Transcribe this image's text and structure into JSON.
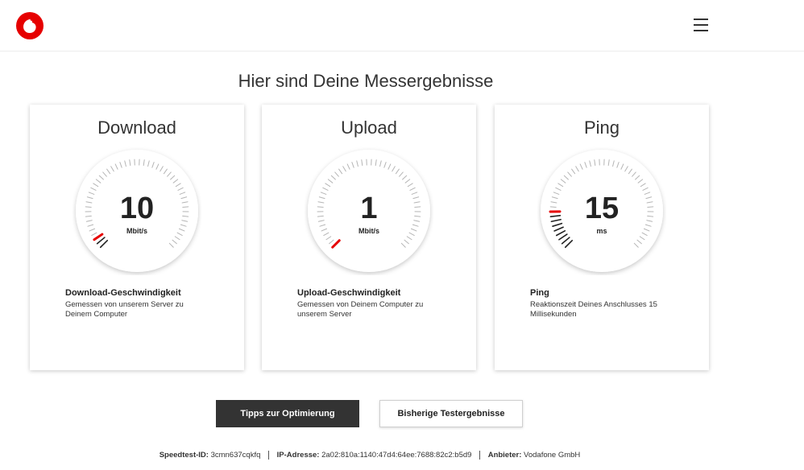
{
  "header": {
    "logo": "vodafone-logo",
    "menu_icon": "hamburger-icon"
  },
  "page_title": "Hier sind Deine Messergebnisse",
  "cards": [
    {
      "title": "Download",
      "value": "10",
      "unit": "Mbit/s",
      "label": "Download-Geschwindigkeit",
      "description": "Gemessen von unserem Server zu Deinem Computer",
      "level": 0.06
    },
    {
      "title": "Upload",
      "value": "1",
      "unit": "Mbit/s",
      "label": "Upload-Geschwindigkeit",
      "description": "Gemessen von Deinem Computer zu unserem Server",
      "level": 0.01
    },
    {
      "title": "Ping",
      "value": "15",
      "unit": "ms",
      "label": "Ping",
      "description": "Reaktionszeit Deines Anschlusses 15 Millisekunden",
      "level": 0.17
    }
  ],
  "buttons": {
    "tips": "Tipps zur Optimierung",
    "history": "Bisherige Testergebnisse"
  },
  "footer": {
    "speedtest_label": "Speedtest-ID:",
    "speedtest_id": "3cmn637cqkfq",
    "ip_label": "IP-Adresse:",
    "ip": "2a02:810a:1140:47d4:64ee:7688:82c2:b5d9",
    "provider_label": "Anbieter:",
    "provider": "Vodafone GmbH"
  },
  "colors": {
    "accent": "#e60000",
    "primary_button": "#333333"
  }
}
